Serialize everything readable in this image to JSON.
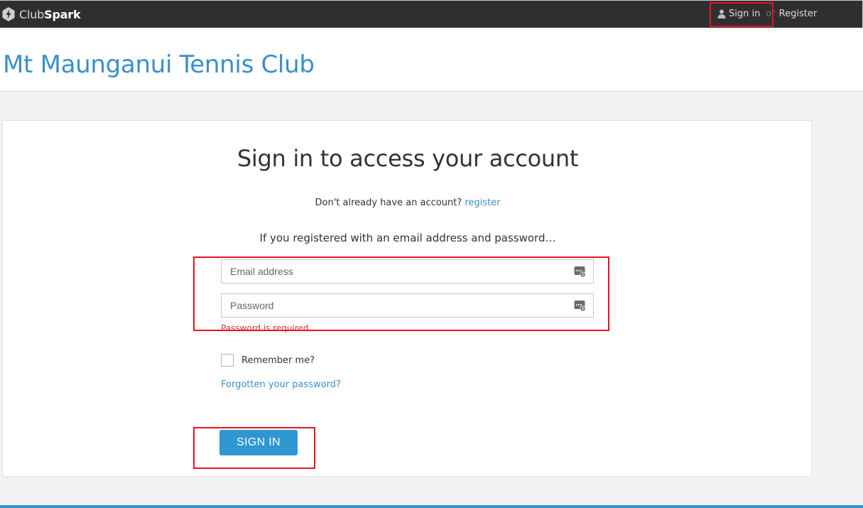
{
  "brand": {
    "name_light": "Club",
    "name_bold": "Spark",
    "icon": "bolt-icon"
  },
  "topnav": {
    "user_icon": "user-icon",
    "signin_label": "Sign in",
    "or_label": "or",
    "register_label": "Register"
  },
  "club": {
    "title": "Mt Maunganui Tennis Club"
  },
  "form": {
    "heading": "Sign in to access your account",
    "no_account_text": "Don't already have an account?",
    "register_link": "register",
    "intro": "If you registered with an email address and password…",
    "email": {
      "value": "",
      "placeholder": "Email address",
      "icon": "keyboard-icon"
    },
    "password": {
      "value": "",
      "placeholder": "Password",
      "icon": "keyboard-icon"
    },
    "error": "Password is required",
    "remember_label": "Remember me?",
    "remember_checked": false,
    "forgot_label": "Forgotten your password?",
    "submit_label": "SIGN IN"
  },
  "colors": {
    "topbar_bg": "#2f2f2f",
    "accent_blue": "#3a8fc9",
    "button_blue": "#2e97d2",
    "error_red": "#d9342b",
    "highlight_red": "#e8131f",
    "page_bg": "#f2f2f2"
  }
}
